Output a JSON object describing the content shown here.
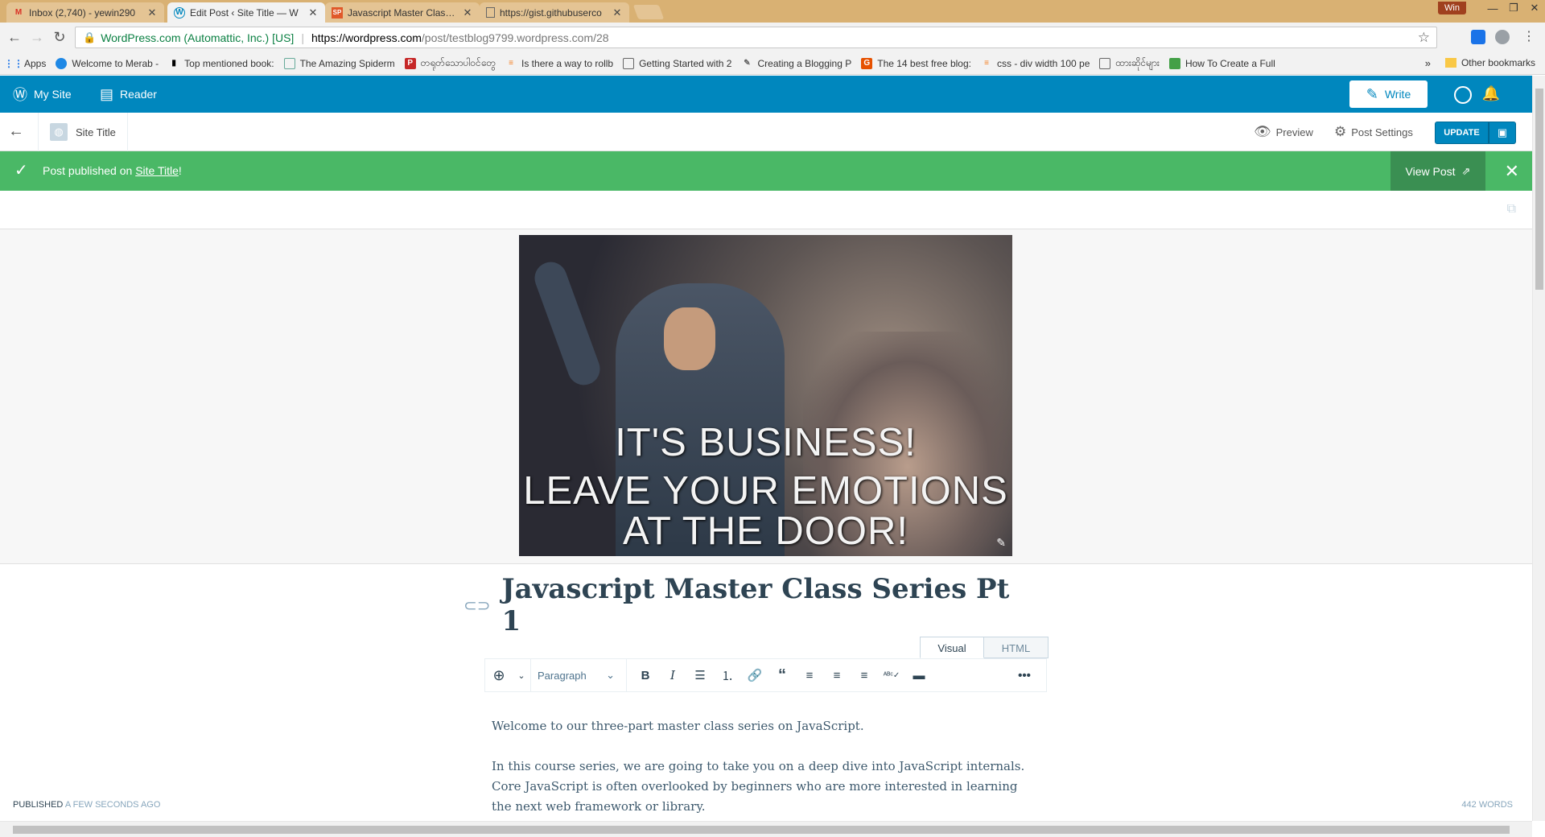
{
  "browser": {
    "tabs": [
      {
        "title": "Inbox (2,740) - yewin290",
        "icon": "gmail-icon"
      },
      {
        "title": "Edit Post ‹ Site Title — W",
        "icon": "wordpress-icon"
      },
      {
        "title": "Javascript Master Class S",
        "icon": "sp-icon"
      },
      {
        "title": "https://gist.githubuserco",
        "icon": "page-icon"
      }
    ],
    "win_badge": "Win",
    "url_secure": "WordPress.com (Automattic, Inc.) [US]",
    "url_host": "https://wordpress.com",
    "url_path": "/post/testblog9799.wordpress.com/28",
    "bookmarks": [
      "Apps",
      "Welcome to Merab -",
      "Top mentioned book:",
      "The Amazing Spiderm",
      "တရုတ်သောပါဝင်တွေ",
      "Is there a way to rollb",
      "Getting Started with 2",
      "Creating a Blogging P",
      "The 14 best free blog:",
      "css - div width 100 pe",
      "ထားဆိုင်များ",
      "How To Create a Full"
    ],
    "bookmarks_more": "»",
    "other_bookmarks": "Other bookmarks"
  },
  "masterbar": {
    "my_site": "My Site",
    "reader": "Reader",
    "write": "Write"
  },
  "editor_bar": {
    "site_title": "Site Title",
    "preview": "Preview",
    "post_settings": "Post Settings",
    "update": "UPDATE"
  },
  "notice": {
    "prefix": "Post published on ",
    "link": "Site Title",
    "suffix": "!",
    "view_post": "View Post"
  },
  "featured_image": {
    "caption_lines": [
      "IT'S BUSINESS!",
      "LEAVE YOUR EMOTIONS",
      "AT THE DOOR!"
    ]
  },
  "post": {
    "title": "Javascript Master Class Series Pt 1",
    "tab_visual": "Visual",
    "tab_html": "HTML",
    "format": "Paragraph",
    "paragraphs": [
      "Welcome to our three-part master class series on JavaScript.",
      "In this course series, we are going to take you on a deep dive into JavaScript internals. Core JavaScript is often overlooked by beginners who are more interested in learning the next web framework or library."
    ]
  },
  "footer": {
    "status": "PUBLISHED",
    "when": "A FEW SECONDS AGO",
    "words": "442 WORDS"
  },
  "colors": {
    "masterbar": "#0087be",
    "notice": "#4ab866",
    "tabstrip": "#d9b173"
  }
}
